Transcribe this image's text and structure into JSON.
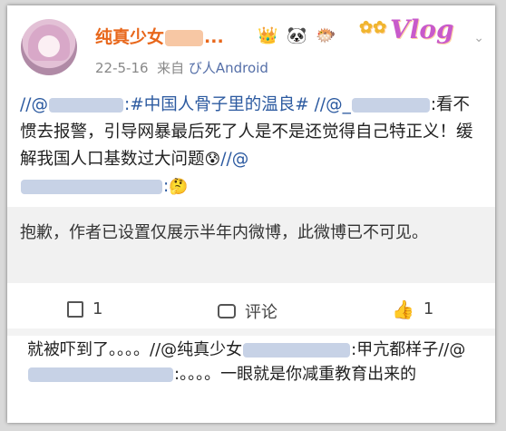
{
  "post": {
    "username": "纯真少女",
    "username_suffix": "...",
    "badges": [
      "👑",
      "🐼",
      "🐡"
    ],
    "date": "22-5-16",
    "from_label": "来自",
    "source": "び人Android",
    "content": {
      "p1": "//@",
      "hashtag": ":#中国人骨子里的温良#",
      "p2": " //@_",
      "p3": ":看不惯去报警，引导网暴最后死了人是不是还觉得自己特正义！缓解我国人口基数过大问题",
      "emoji1": "😰",
      "p4": "//@",
      "p5": ":",
      "emoji2": "🤔"
    }
  },
  "quote": {
    "text": "抱歉，作者已设置仅展示半年内微博，此微博已不可见。"
  },
  "actions": {
    "repost_count": "1",
    "comment_label": "评论",
    "like_count": "1"
  },
  "comment": {
    "c1": "就被吓到了。。。。//@纯真少女",
    "c2": ":甲亢都样子//@",
    "c3": ":。。。。一眼就是你减重教育出来的"
  },
  "vlog": {
    "text": "Vlog"
  }
}
